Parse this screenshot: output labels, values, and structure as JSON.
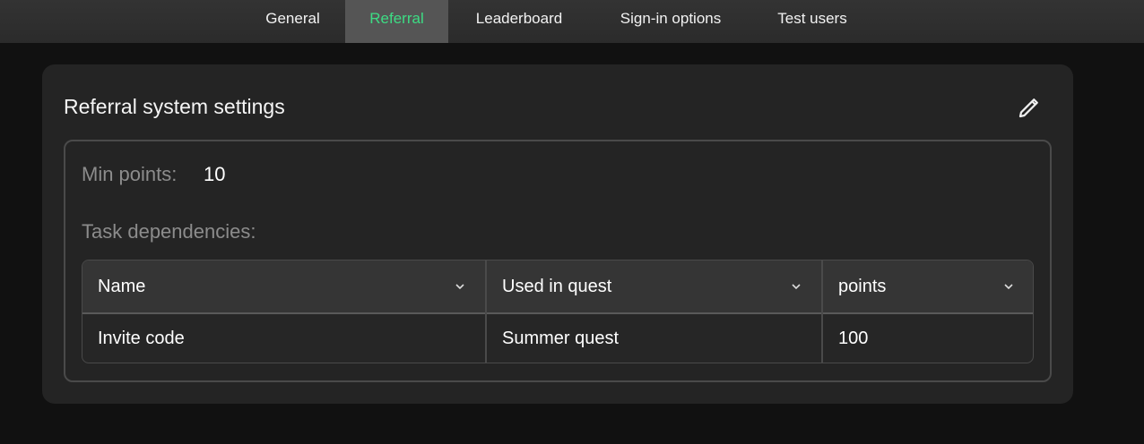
{
  "tabs": [
    {
      "label": "General"
    },
    {
      "label": "Referral"
    },
    {
      "label": "Leaderboard"
    },
    {
      "label": "Sign-in options"
    },
    {
      "label": "Test users"
    }
  ],
  "active_tab": "Referral",
  "accent_color": "#3ddc84",
  "card": {
    "title": "Referral system settings",
    "edit_icon": "pencil-icon",
    "min_points_label": "Min points:",
    "min_points_value": "10",
    "task_dependencies_label": "Task dependencies:",
    "table": {
      "columns": [
        "Name",
        "Used in quest",
        "points"
      ],
      "rows": [
        [
          "Invite code",
          "Summer quest",
          "100"
        ]
      ]
    }
  }
}
